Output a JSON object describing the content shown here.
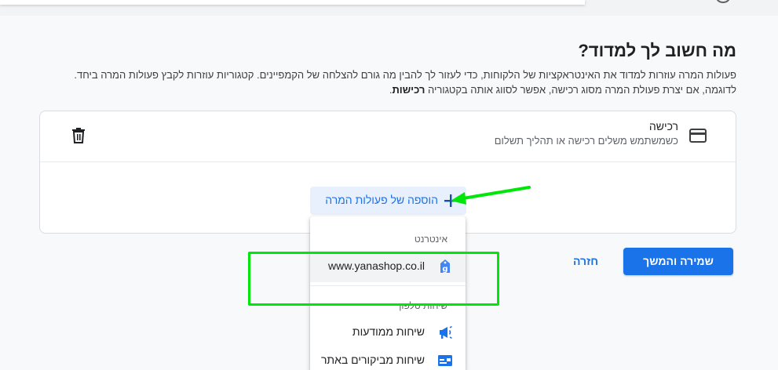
{
  "header": {
    "title": "מה חשוב לך למדוד?",
    "description_line1": "פעולות המרה עוזרות למדוד את האינטראקציות של הלקוחות, כדי לעזור לך להבין מה גורם להצלחה של הקמפיינים. קטגוריות עוזרות לקבץ פעולות המרה ביחד.",
    "description_line2_prefix": "לדוגמה, אם יצרת פעולת המרה מסוג רכישה, אפשר לסווג אותה בקטגוריה ",
    "description_line2_bold": "רכישות",
    "description_line2_suffix": "."
  },
  "conversion_card": {
    "name": "רכישה",
    "subtitle": "כשמשתמש משלים רכישה או תהליך תשלום",
    "icon": "credit-card-icon",
    "delete_icon": "trash-icon"
  },
  "add_button": {
    "label": "הוספה של פעולות המרה",
    "icon": "plus-icon"
  },
  "dropdown": {
    "section_web": "אינטרנט",
    "website_item": "www.yanashop.co.il",
    "section_phone": "שיחות טלפון",
    "items": [
      {
        "label": "שיחות ממודעות",
        "icon": "megaphone-icon"
      },
      {
        "label": "שיחות מביקורים באתר",
        "icon": "website-card-icon"
      }
    ]
  },
  "footer": {
    "save_label": "שמירה והמשך",
    "back_label": "חזרה"
  },
  "colors": {
    "accent": "#1a73e8",
    "annotation": "#00e60b"
  }
}
